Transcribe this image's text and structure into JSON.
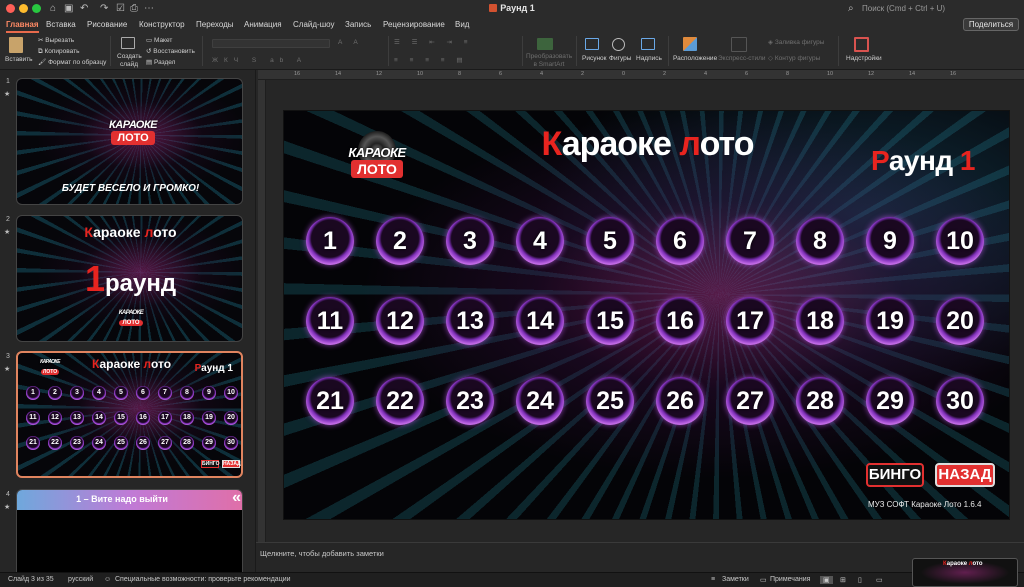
{
  "window": {
    "title": "Раунд 1",
    "search_placeholder": "Поиск (Cmd + Ctrl + U)",
    "share_label": "Поделиться"
  },
  "tabs": [
    "Главная",
    "Вставка",
    "Рисование",
    "Конструктор",
    "Переходы",
    "Анимация",
    "Слайд-шоу",
    "Запись",
    "Рецензирование",
    "Вид"
  ],
  "ribbon": {
    "paste": "Вставить",
    "cut": "Вырезать",
    "copy": "Копировать",
    "format_painter": "Формат по образцу",
    "new_slide": "Создать слайд",
    "layout": "Макет",
    "reset": "Восстановить",
    "section": "Раздел",
    "smartart": "Преобразовать в SmartArt",
    "picture": "Рисунок",
    "shapes": "Фигуры",
    "textbox": "Надпись",
    "arrange": "Расположение",
    "quick_styles": "Экспресс-стили",
    "shape_fill": "Заливка фигуры",
    "shape_outline": "Контур фигуры",
    "addins": "Надстройки"
  },
  "ruler_ticks": [
    "16",
    "14",
    "12",
    "10",
    "8",
    "6",
    "4",
    "2",
    "0",
    "2",
    "4",
    "6",
    "8",
    "10",
    "12",
    "14",
    "16"
  ],
  "thumbnails": [
    {
      "num": "1",
      "caption": "БУДЕТ ВЕСЕЛО И ГРОМКО!"
    },
    {
      "num": "2",
      "title_a": "К",
      "title_b": "араоке ",
      "title_c": "л",
      "title_d": "ото",
      "big_num": "1",
      "round_word": "раунд"
    },
    {
      "num": "3",
      "title_a": "К",
      "title_b": "араоке ",
      "title_c": "л",
      "title_d": "ото",
      "round_a": "Р",
      "round_b": "аунд 1",
      "bingo": "БИНГО",
      "back": "НАЗАД"
    },
    {
      "num": "4",
      "header": "1 – Вите надо выйти",
      "arrow": "«"
    }
  ],
  "logo": {
    "top": "КАРАОКЕ",
    "bottom": "ЛОТО"
  },
  "slide": {
    "title_a": "К",
    "title_b": "араоке ",
    "title_c": "л",
    "title_d": "ото",
    "round_a": "Р",
    "round_b": "аунд ",
    "round_c": "1",
    "numbers": [
      "1",
      "2",
      "3",
      "4",
      "5",
      "6",
      "7",
      "8",
      "9",
      "10",
      "11",
      "12",
      "13",
      "14",
      "15",
      "16",
      "17",
      "18",
      "19",
      "20",
      "21",
      "22",
      "23",
      "24",
      "25",
      "26",
      "27",
      "28",
      "29",
      "30"
    ],
    "bingo": "БИНГО",
    "back": "НАЗАД",
    "credit": "МУЗ СОФТ  Караоке Лото 1.6.4"
  },
  "notes_placeholder": "Щелкните, чтобы добавить заметки",
  "status": {
    "slide_count": "Слайд 3 из 35",
    "language": "русский",
    "accessibility": "Специальные возможности: проверьте рекомендации",
    "notes": "Заметки",
    "comments": "Примечания"
  }
}
